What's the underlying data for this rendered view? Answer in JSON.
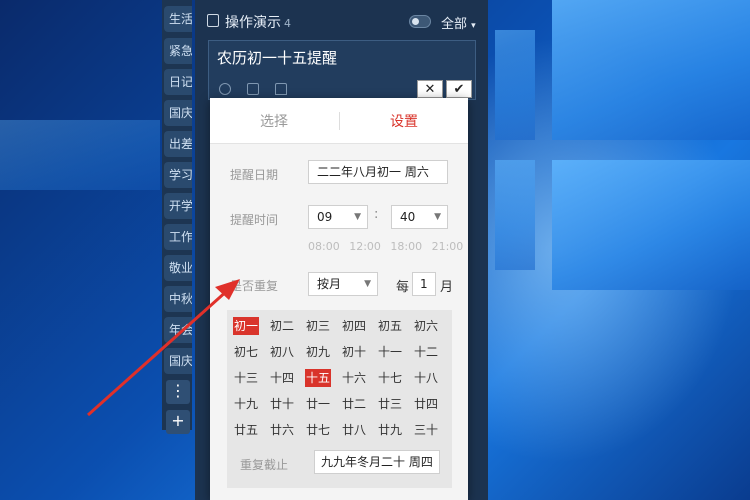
{
  "sidebar": {
    "items": [
      "生活",
      "紧急",
      "日记",
      "国庆",
      "出差",
      "学习",
      "开学",
      "工作",
      "敬业",
      "中秋",
      "年会",
      "国庆"
    ],
    "more_label": "⋮",
    "add_label": "+"
  },
  "panel": {
    "title": "操作演示",
    "count": "4",
    "filter_label": "全部",
    "note_text": "农历初一十五提醒",
    "cancel_label": "✕",
    "confirm_label": "✔"
  },
  "popup": {
    "tab_select": "选择",
    "tab_settings": "设置",
    "remind_date_label": "提醒日期",
    "remind_date_value": "二二年八月初一  周六",
    "remind_time_label": "提醒时间",
    "hour_value": "09",
    "minute_value": "40",
    "time_separator": ":",
    "presets": "08:00 12:00 18:00 21:00",
    "repeat_label": "是否重复",
    "repeat_value": "按月",
    "every_label": "每",
    "every_value": "1",
    "month_label": "月",
    "days": [
      [
        "初一",
        "初二",
        "初三",
        "初四",
        "初五",
        "初六"
      ],
      [
        "初七",
        "初八",
        "初九",
        "初十",
        "十一",
        "十二"
      ],
      [
        "十三",
        "十四",
        "十五",
        "十六",
        "十七",
        "十八"
      ],
      [
        "十九",
        "廿十",
        "廿一",
        "廿二",
        "廿三",
        "廿四"
      ],
      [
        "廿五",
        "廿六",
        "廿七",
        "廿八",
        "廿九",
        "三十"
      ]
    ],
    "selected_days": [
      "初一",
      "十五"
    ],
    "repeat_end_label": "重复截止",
    "repeat_end_value": "九九年冬月二十  周四"
  },
  "colors": {
    "accent_red": "#d9342b",
    "panel_bg": "#1c3350"
  }
}
